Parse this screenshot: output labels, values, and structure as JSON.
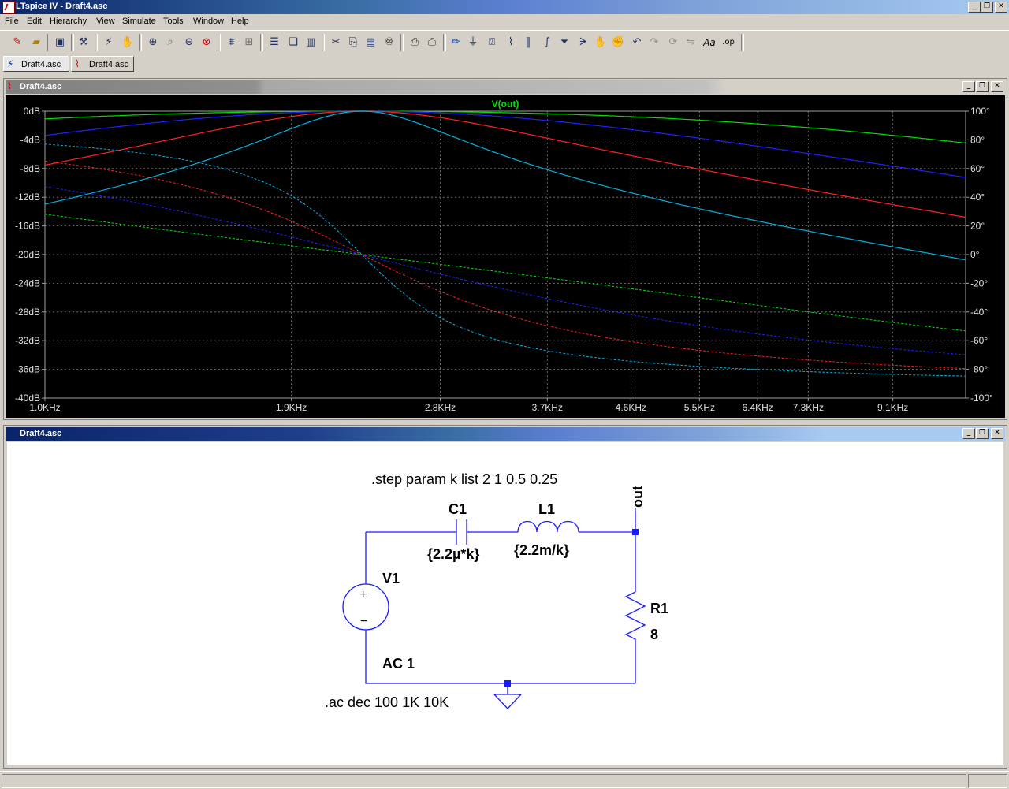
{
  "app": {
    "title": "LTspice IV - Draft4.asc",
    "window_controls": [
      "_",
      "❐",
      "✕"
    ]
  },
  "menu": [
    "File",
    "Edit",
    "Hierarchy",
    "View",
    "Simulate",
    "Tools",
    "Window",
    "Help"
  ],
  "toolbar": {
    "icons": [
      "new-schematic-icon",
      "open-icon",
      "save-icon",
      "control-panel-icon",
      "run-icon",
      "halt-icon",
      "zoom-in-icon",
      "zoom-pan-icon",
      "zoom-out-icon",
      "zoom-full-icon",
      "autorange-icon",
      "grid-icon",
      "tile-horizontal-icon",
      "cascade-icon",
      "tile-vertical-icon",
      "cut-icon",
      "copy-icon",
      "paste-icon",
      "find-icon",
      "print-preview-icon",
      "print-icon",
      "wire-icon",
      "ground-icon",
      "label-net-icon",
      "resistor-icon",
      "capacitor-icon",
      "inductor-icon",
      "diode-icon",
      "component-icon",
      "move-icon",
      "drag-icon",
      "undo-icon",
      "redo-icon",
      "rotate-icon",
      "mirror-icon",
      "text-icon",
      "spice-directive-icon"
    ]
  },
  "tabs": [
    {
      "label": "Draft4.asc",
      "icon": "schematic-icon"
    },
    {
      "label": "Draft4.asc",
      "icon": "waveform-icon"
    }
  ],
  "plot_window": {
    "title": "Draft4.asc",
    "trace_label": "V(out)"
  },
  "schematic_window": {
    "title": "Draft4.asc"
  },
  "schematic": {
    "step_directive": ".step param k list 2 1 0.5 0.25",
    "ac_directive": ".ac dec 100 1K 10K",
    "c1_name": "C1",
    "c1_value": "{2.2µ*k}",
    "l1_name": "L1",
    "l1_value": "{2.2m/k}",
    "v1_name": "V1",
    "v1_value": "AC 1",
    "r1_name": "R1",
    "r1_value": "8",
    "net_label": "out",
    "plus_sign": "+",
    "minus_sign": "−"
  },
  "chart_data": {
    "type": "line",
    "title": "V(out)",
    "x_scale": "log",
    "xlim": [
      1000,
      11000
    ],
    "x_ticks": [
      1000,
      1900,
      2800,
      3700,
      4600,
      5500,
      6400,
      7300,
      9100
    ],
    "x_tick_labels": [
      "1.0KHz",
      "1.9KHz",
      "2.8KHz",
      "3.7KHz",
      "4.6KHz",
      "5.5KHz",
      "6.4KHz",
      "7.3KHz",
      "9.1KHz"
    ],
    "ylim": [
      -40,
      0
    ],
    "y_ticks": [
      0,
      -4,
      -8,
      -12,
      -16,
      -20,
      -24,
      -28,
      -32,
      -36,
      -40
    ],
    "y_tick_labels": [
      "0dB",
      "-4dB",
      "-8dB",
      "-12dB",
      "-16dB",
      "-20dB",
      "-24dB",
      "-28dB",
      "-32dB",
      "-36dB",
      "-40dB"
    ],
    "y2lim": [
      -100,
      100
    ],
    "y2_ticks": [
      100,
      80,
      60,
      40,
      20,
      0,
      -20,
      -40,
      -60,
      -80,
      -100
    ],
    "y2_tick_labels": [
      "100°",
      "80°",
      "60°",
      "40°",
      "20°",
      "0°",
      "-20°",
      "-40°",
      "-60°",
      "-80°",
      "-100°"
    ],
    "grid": true,
    "resonance_hz": 2283,
    "series": [
      {
        "k": 2,
        "color": "#00e000",
        "q": 0.29
      },
      {
        "k": 1,
        "color": "#2020ff",
        "q": 0.59
      },
      {
        "k": 0.5,
        "color": "#ff2020",
        "q": 1.17
      },
      {
        "k": 0.25,
        "color": "#00b0e0",
        "q": 2.35
      }
    ]
  }
}
